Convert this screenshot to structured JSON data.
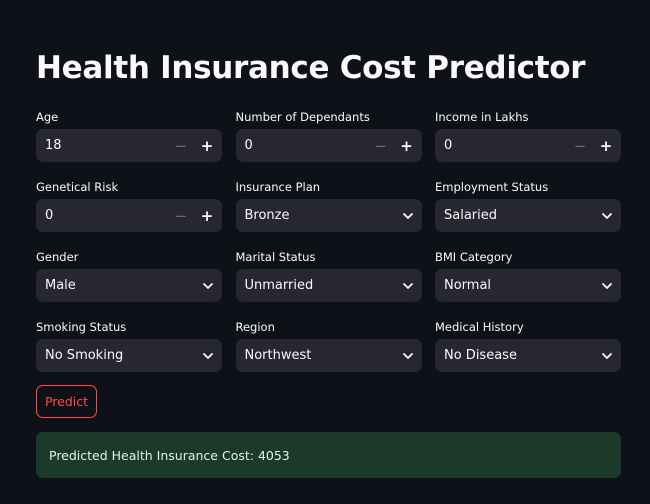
{
  "title": "Health Insurance Cost Predictor",
  "fields": {
    "age": {
      "label": "Age",
      "value": "18"
    },
    "dependants": {
      "label": "Number of Dependants",
      "value": "0"
    },
    "income": {
      "label": "Income in Lakhs",
      "value": "0"
    },
    "genetical_risk": {
      "label": "Genetical Risk",
      "value": "0"
    },
    "insurance_plan": {
      "label": "Insurance Plan",
      "value": "Bronze"
    },
    "employment_status": {
      "label": "Employment Status",
      "value": "Salaried"
    },
    "gender": {
      "label": "Gender",
      "value": "Male"
    },
    "marital_status": {
      "label": "Marital Status",
      "value": "Unmarried"
    },
    "bmi_category": {
      "label": "BMI Category",
      "value": "Normal"
    },
    "smoking_status": {
      "label": "Smoking Status",
      "value": "No Smoking"
    },
    "region": {
      "label": "Region",
      "value": "Northwest"
    },
    "medical_history": {
      "label": "Medical History",
      "value": "No Disease"
    }
  },
  "stepper": {
    "minus": "−",
    "plus": "+"
  },
  "predict_label": "Predict",
  "result_text": "Predicted Health Insurance Cost: 4053",
  "colors": {
    "background": "#0e1117",
    "input_bg": "#262730",
    "accent": "#ff4b4b",
    "success_bg": "#1b3a29"
  },
  "icons": {
    "stepper_minus": "minus-icon",
    "stepper_plus": "plus-icon",
    "select_chevron": "chevron-down-icon"
  }
}
